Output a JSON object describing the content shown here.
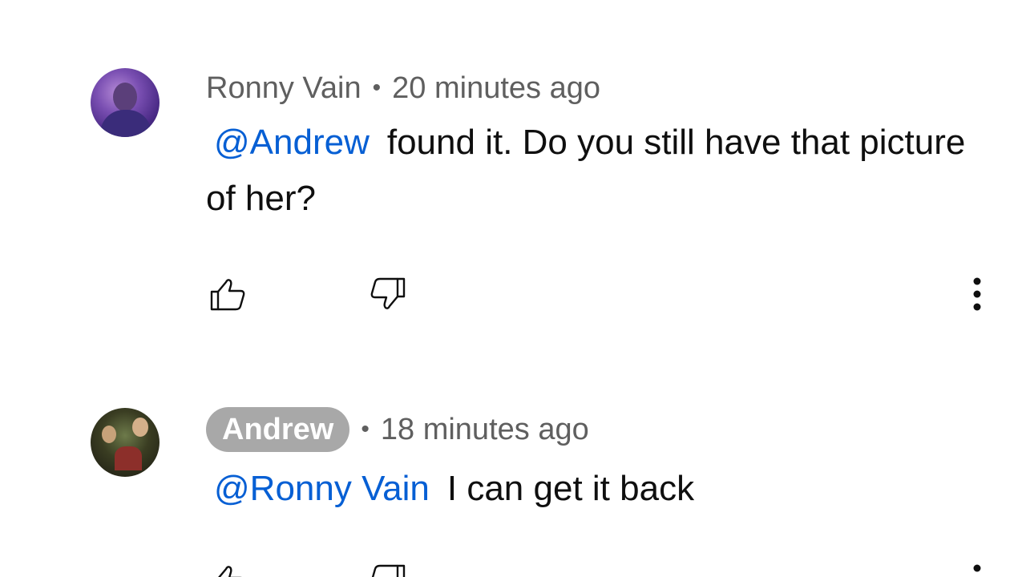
{
  "comments": [
    {
      "author": "Ronny Vain",
      "separator": "•",
      "time": "20 minutes ago",
      "mention": "@Andrew",
      "text": "found it. Do you still have that picture of her?",
      "icons": {
        "like": "thumbs-up-icon",
        "dislike": "thumbs-down-icon",
        "more": "more-vertical-icon"
      }
    },
    {
      "author": "Andrew",
      "author_is_creator": true,
      "separator": "•",
      "time": "18 minutes ago",
      "mention": "@Ronny Vain",
      "text": "I can get it back",
      "icons": {
        "like": "thumbs-up-icon",
        "dislike": "thumbs-down-icon",
        "more": "more-vertical-icon"
      }
    }
  ],
  "colors": {
    "mention": "#065fd4",
    "meta_text": "#5f5f5f",
    "creator_chip": "#a8a8a8"
  }
}
